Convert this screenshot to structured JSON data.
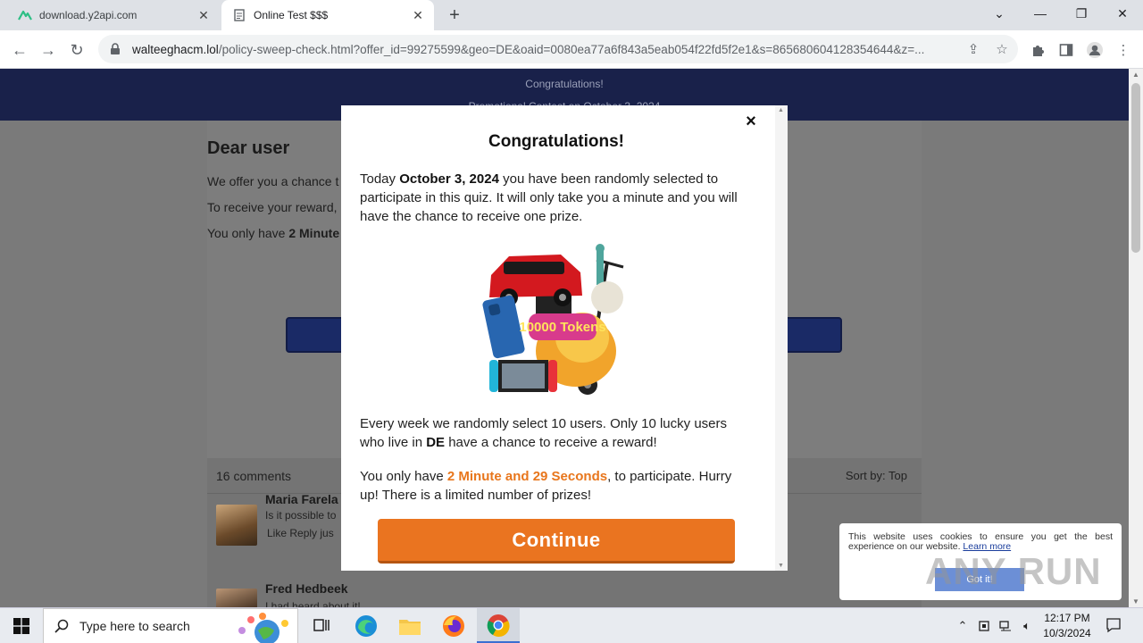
{
  "browser": {
    "tabs": [
      {
        "title": "download.y2api.com",
        "favicon": "y2api-logo-icon"
      },
      {
        "title": "Online Test $$$",
        "favicon": "document-icon"
      }
    ],
    "url_host": "walteeghacm.lol",
    "url_rest": "/policy-sweep-check.html?offer_id=99275599&geo=DE&oaid=0080ea77a6f843a5eab054f22fd5f2e1&s=865680604128354644&z=..."
  },
  "page": {
    "banner_line1": "Congratulations!",
    "banner_line2": "Promotional Contest on October 3, 2024",
    "heading": "Dear user",
    "line1": "We offer you a chance t",
    "line2": "To receive your reward,",
    "line3_prefix": "You only have ",
    "line3_bold": "2 Minute",
    "comments_count": "16 comments",
    "sort_label": "Sort by:",
    "sort_value": "Top",
    "comments": [
      {
        "name": "Maria Farela",
        "text": "Is it possible to",
        "meta": "Like Reply  jus"
      },
      {
        "name": "Fred Hedbeek",
        "text": "I had heard about it!"
      }
    ]
  },
  "modal": {
    "title": "Congratulations!",
    "p1_a": "Today ",
    "p1_date": "October 3, 2024",
    "p1_b": " you have been randomly selected to participate in this quiz. It will only take you a minute and you will have the chance to receive one prize.",
    "p2_a": "Every week we randomly select 10 users. Only 10 lucky users who live in ",
    "p2_geo": "DE",
    "p2_b": " have a chance to receive a reward!",
    "p3_a": "You only have ",
    "p3_timer": "2 Minute and 29 Seconds",
    "p3_b": ", to participate. Hurry up! There is a limited number of prizes!",
    "prize_tokens": "10000 Tokens",
    "continue_label": "Continue",
    "close_label": "×"
  },
  "cookie": {
    "text": "This website uses cookies to ensure you get the best experience on our website. ",
    "link": "Learn more",
    "button": "Got it!"
  },
  "watermark": "ANY RUN",
  "taskbar": {
    "search_placeholder": "Type here to search",
    "time": "12:17 PM",
    "date": "10/3/2024"
  },
  "colors": {
    "banner": "#19214a",
    "accent_orange": "#ea7420",
    "timer_orange": "#e8761c"
  }
}
